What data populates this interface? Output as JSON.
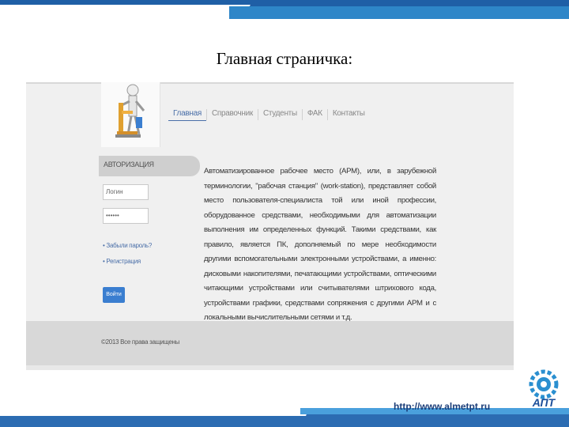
{
  "slide": {
    "title": "Главная страничка:",
    "url": "http://www.almetpt.ru",
    "logo_text": "АПТ"
  },
  "site": {
    "nav": [
      "Главная",
      "Справочник",
      "Студенты",
      "ФАК",
      "Контакты"
    ],
    "login": {
      "header": "АВТОРИЗАЦИЯ",
      "login_value": "Логин",
      "password_value": "••••••",
      "links": [
        "• Забыли пароль?",
        "• Регистрация"
      ],
      "button": "Войти"
    },
    "content": "Автоматизированное рабочее место (АРМ), или, в зарубежной терминологии, \"рабочая станция\" (work-station), представляет собой место пользователя-специалиста той или иной профессии, оборудованное средствами, необходимыми для автоматизации выполнения им определенных функций. Такими средствами, как правило, является ПК, дополняемый по мере необходимости другими вспомогательными электронными устройствами, а именно: дисковыми накопителями, печатающими устройствами, оптическими читающими устройствами или считывателями штрихового кода, устройствами графики, средствами сопряжения с другими АРМ и с локальными вычислительными сетями и т.д.",
    "footer": "©2013 Все права защищены"
  }
}
